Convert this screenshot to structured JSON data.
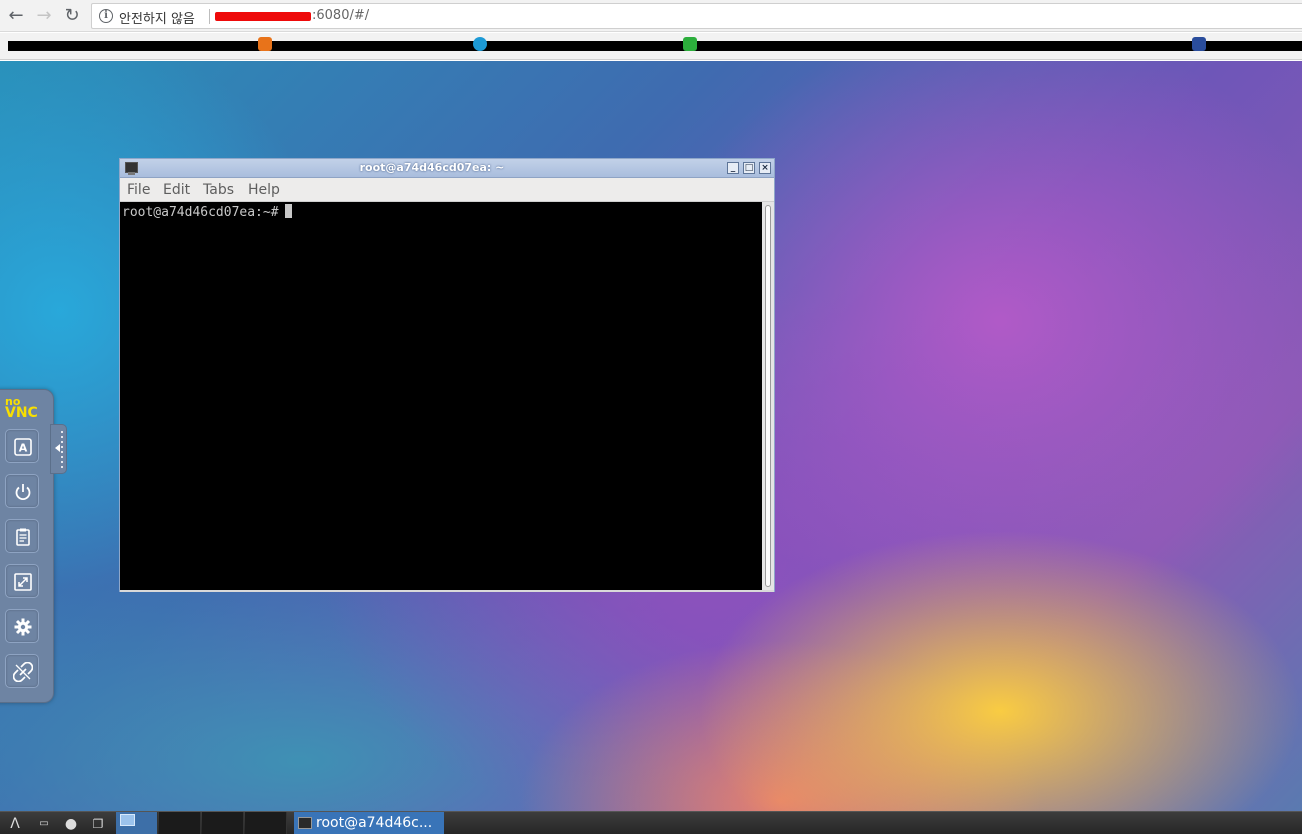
{
  "browser": {
    "security_label": "안전하지 않음",
    "url_visible": ":6080/#/"
  },
  "terminal": {
    "title": "root@a74d46cd07ea: ~",
    "menu": [
      "File",
      "Edit",
      "Tabs",
      "Help"
    ],
    "prompt": "root@a74d46cd07ea:~#"
  },
  "novnc": {
    "logo_top": "no",
    "logo_bottom": "VNC",
    "buttons": [
      "keyboard-icon",
      "power-icon",
      "clipboard-icon",
      "fullscreen-icon",
      "settings-icon",
      "disconnect-icon"
    ]
  },
  "taskbar": {
    "task_label": "root@a74d46c..."
  },
  "colors": {
    "novnc_panel": "#6e84a3",
    "taskbar_task": "#3974b8",
    "url_redaction": "#ee0a0a"
  }
}
